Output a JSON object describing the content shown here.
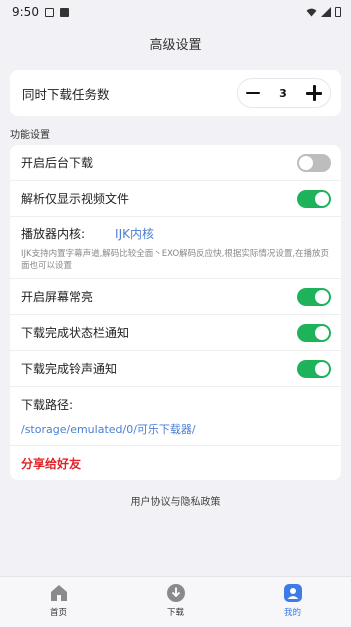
{
  "status": {
    "time": "9:50"
  },
  "header": {
    "title": "高级设置"
  },
  "concurrent": {
    "label": "同时下载任务数",
    "count": "3"
  },
  "section": {
    "label": "功能设置"
  },
  "settings": {
    "background_download": {
      "label": "开启后台下载",
      "on": false
    },
    "parse_video_only": {
      "label": "解析仅显示视频文件",
      "on": true
    },
    "player": {
      "label": "播放器内核:",
      "value": "IJK内核",
      "description": "IJK支持内置字幕声道,解码比较全面丶EXO解码反应快,根据实际情况设置,在播放页面也可以设置"
    },
    "screen_on": {
      "label": "开启屏幕常亮",
      "on": true
    },
    "notify_statusbar": {
      "label": "下载完成状态栏通知",
      "on": true
    },
    "notify_sound": {
      "label": "下载完成铃声通知",
      "on": true
    },
    "download_path": {
      "label": "下载路径:",
      "value": "/storage/emulated/0/可乐下载器/"
    },
    "share": {
      "label": "分享给好友"
    }
  },
  "footer": {
    "policy": "用户协议与隐私政策"
  },
  "nav": {
    "home": "首页",
    "download": "下载",
    "mine": "我的",
    "active": "mine",
    "accent": "#3d7be6"
  },
  "colors": {
    "toggle_on": "#1eb35b",
    "toggle_off": "#bdbdc0",
    "link": "#4a7fd4",
    "share": "#e0242a"
  }
}
